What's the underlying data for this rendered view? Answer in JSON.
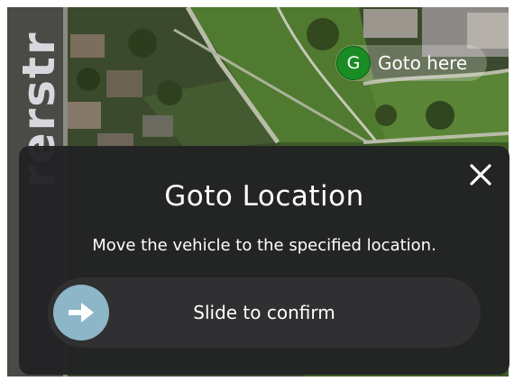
{
  "map": {
    "street_label": "rerstr",
    "goto_chip": {
      "marker_letter": "G",
      "label": "Goto here",
      "marker_color": "#1a8c24"
    }
  },
  "dialog": {
    "title": "Goto Location",
    "message": "Move the vehicle to the specified location.",
    "close_icon": "close-icon",
    "slider": {
      "label": "Slide to confirm",
      "thumb_icon": "arrow-right-icon",
      "thumb_color": "#8db6c8",
      "progress": 0
    }
  }
}
